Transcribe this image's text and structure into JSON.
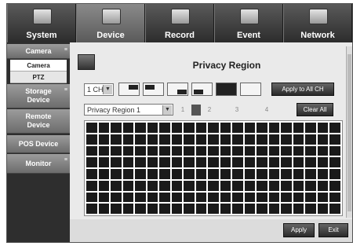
{
  "nav": {
    "tabs": [
      {
        "label": "System",
        "icon": "monitor-icon"
      },
      {
        "label": "Device",
        "icon": "camera-icon"
      },
      {
        "label": "Record",
        "icon": "rec-icon"
      },
      {
        "label": "Event",
        "icon": "event-icon"
      },
      {
        "label": "Network",
        "icon": "network-icon"
      }
    ],
    "active": "Device"
  },
  "sidebar": {
    "camera": "Camera",
    "camera_sub": "Camera",
    "ptz": "PTZ",
    "storage": "Storage Device",
    "remote": "Remote Device",
    "pos": "POS Device",
    "monitor": "Monitor"
  },
  "content": {
    "title": "Privacy Region",
    "channel_select": "1 CH",
    "apply_all_label": "Apply to All CH",
    "region_select": "Privacy Region 1",
    "region_numbers": [
      "1",
      "2",
      "3",
      "4"
    ],
    "clear_all_label": "Clear All",
    "apply_label": "Apply",
    "exit_label": "Exit"
  }
}
